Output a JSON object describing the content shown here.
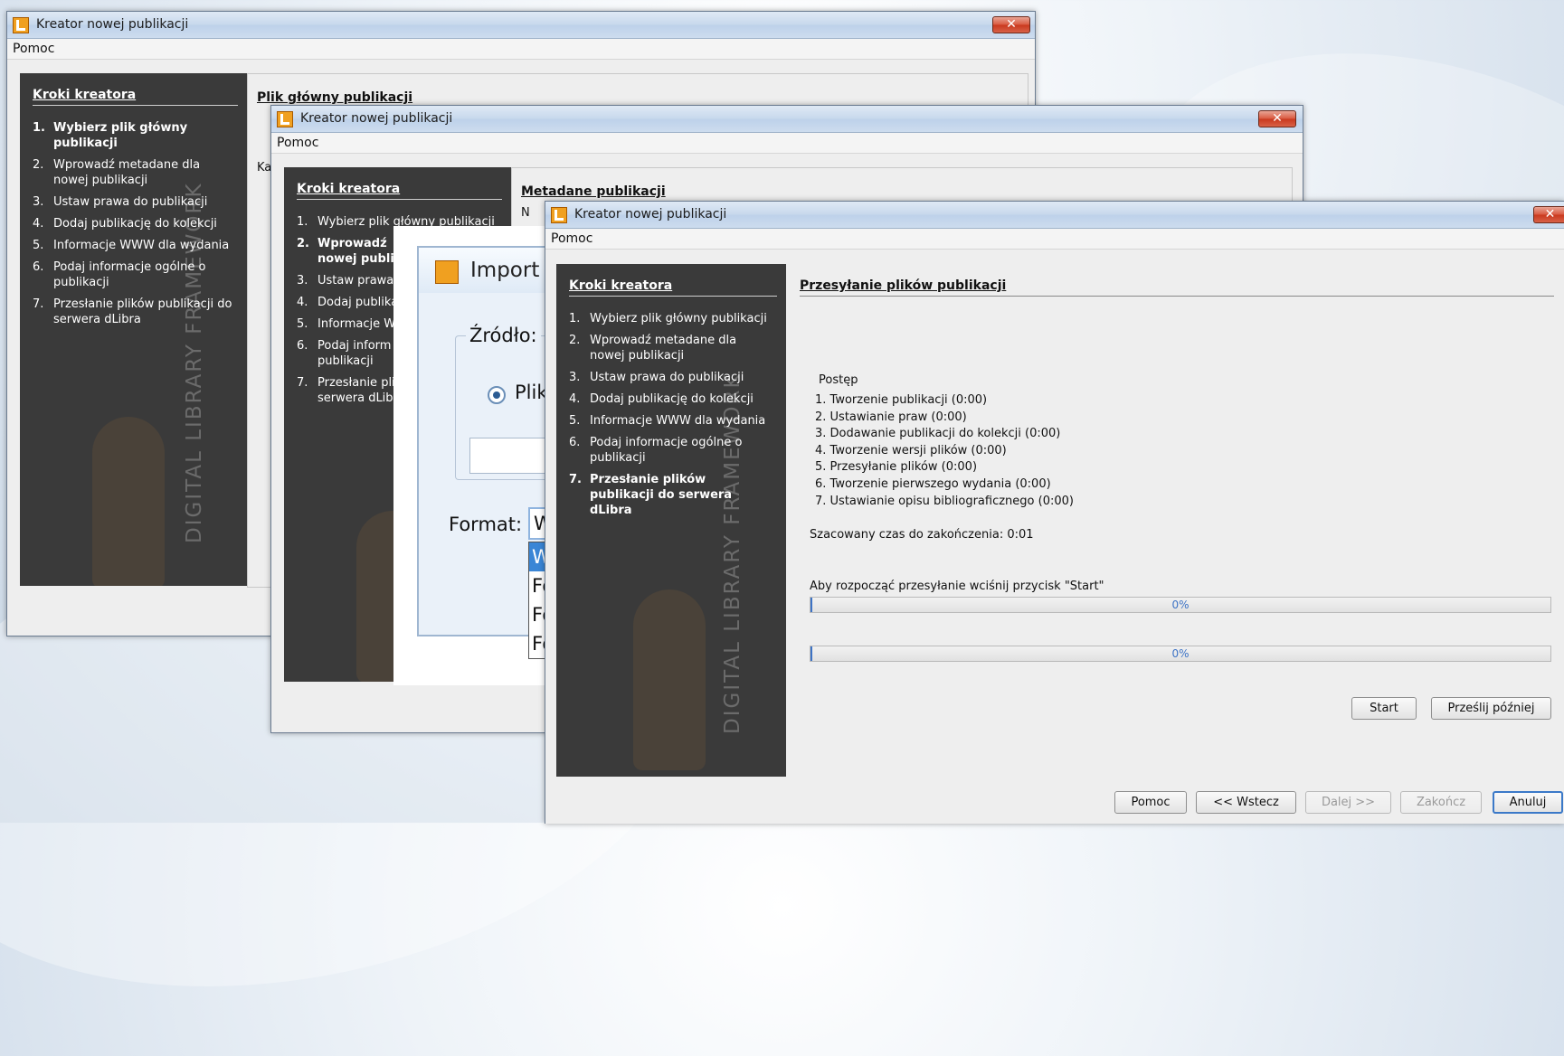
{
  "wizard_title": "Kreator nowej publikacji",
  "menu_help": "Pomoc",
  "close_glyph": "✕",
  "sidebar_title": "Kroki kreatora",
  "watermark": "DIGITAL LIBRARY FRAMEWORK",
  "steps": [
    {
      "num": "1.",
      "label": "Wybierz plik główny publikacji"
    },
    {
      "num": "2.",
      "label": "Wprowadź metadane dla nowej publikacji"
    },
    {
      "num": "3.",
      "label": "Ustaw prawa do publikacji"
    },
    {
      "num": "4.",
      "label": "Dodaj publikację do kolekcji"
    },
    {
      "num": "5.",
      "label": "Informacje WWW dla wydania"
    },
    {
      "num": "6.",
      "label": "Podaj informacje ogólne o publikacji"
    },
    {
      "num": "7.",
      "label": "Przesłanie plików publikacji do serwera dLibra"
    }
  ],
  "window1": {
    "panel_title": "Plik główny publikacji",
    "content_fragment": "Ka",
    "active_step": 1
  },
  "window2": {
    "panel_title": "Metadane publikacji",
    "content_fragment": "N",
    "active_step": 2,
    "steps_truncated": [
      "Wybierz plik główny publikacji",
      "Wprowadź",
      "nowej publi",
      "Ustaw prawa",
      "Dodaj publika",
      "Informacje W",
      "Podaj inform",
      "publikacji",
      "Przesłanie pli",
      "serwera dLibr"
    ]
  },
  "import_dialog": {
    "title": "Import",
    "source_label": "Źródło:",
    "radio_label": "Plik",
    "format_label": "Format:",
    "format_value": "W",
    "dropdown_items": [
      "W",
      "Fo",
      "Fo",
      "Fo"
    ]
  },
  "window3": {
    "active_step": 7,
    "panel_title": "Przesyłanie plików publikacji",
    "progress_header": "Postęp",
    "progress_items": [
      "1. Tworzenie publikacji (0:00)",
      "2. Ustawianie praw (0:00)",
      "3. Dodawanie publikacji do kolekcji (0:00)",
      "4. Tworzenie wersji plików (0:00)",
      "5. Przesyłanie plików (0:00)",
      "6. Tworzenie pierwszego wydania (0:00)",
      "7. Ustawianie opisu bibliograficznego (0:00)"
    ],
    "estimated_time": "Szacowany czas do zakończenia: 0:01",
    "start_hint": "Aby rozpocząć przesyłanie wciśnij przycisk \"Start\"",
    "progress1": {
      "label": "0%",
      "value": 0.0
    },
    "progress2": {
      "label": "0%",
      "value": 0.0
    },
    "start_button": "Start",
    "send_later_button": "Prześlij później",
    "footer_buttons": {
      "help": "Pomoc",
      "back": "<< Wstecz",
      "next": "Dalej >>",
      "finish": "Zakończ",
      "cancel": "Anuluj"
    }
  },
  "colors": {
    "sidebar_bg": "#3a3a3a",
    "progress_accent": "#3d73c5",
    "close_red": "#c9381d"
  }
}
